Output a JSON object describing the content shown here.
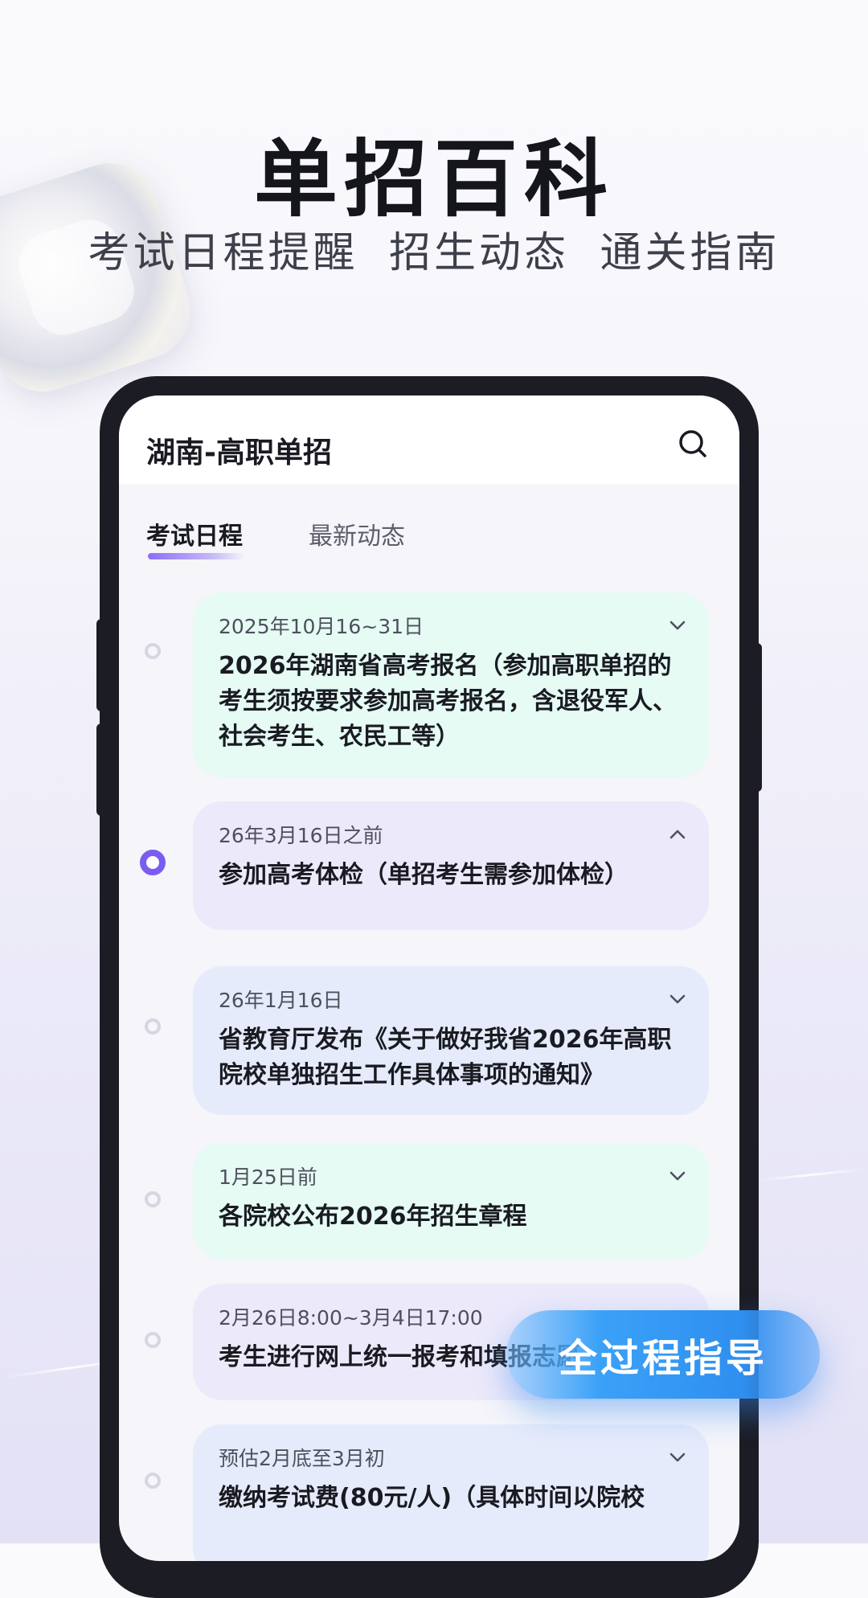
{
  "hero": {
    "title": "单招百科",
    "subtitle": "考试日程提醒  招生动态  通关指南"
  },
  "app": {
    "title": "湖南-高职单招",
    "search_icon": "search-icon"
  },
  "tabs": [
    {
      "label": "考试日程",
      "active": true
    },
    {
      "label": "最新动态",
      "active": false
    }
  ],
  "schedule": [
    {
      "date": "2025年10月16~31日",
      "text": "2026年湖南省高考报名（参加高职单招的考生须按要求参加高考报名，含退役军人、社会考生、农民工等）",
      "expanded": false,
      "color": "#e5fbf4"
    },
    {
      "date": "26年3月16日之前",
      "text": "参加高考体检（单招考生需参加体检）",
      "expanded": true,
      "color": "#ece9fa"
    },
    {
      "date": "26年1月16日",
      "text": "省教育厅发布《关于做好我省2026年高职院校单独招生工作具体事项的通知》",
      "expanded": false,
      "color": "#e6ebfb"
    },
    {
      "date": "1月25日前",
      "text": "各院校公布2026年招生章程",
      "expanded": false,
      "color": "#e5fbf4"
    },
    {
      "date": "2月26日8:00~3月4日17:00",
      "text": "考生进行网上统一报考和填报志愿",
      "expanded": false,
      "color": "#ece9fa"
    },
    {
      "date": "预估2月底至3月初",
      "text": "缴纳考试费(80元/人)（具体时间以院校",
      "expanded": false,
      "color": "#e6ebfb"
    }
  ],
  "cta": {
    "label": "全过程指导"
  },
  "colors": {
    "accent": "#7a5cf2",
    "cta": "#2f8ff0",
    "phone_frame": "#1b1c24"
  }
}
